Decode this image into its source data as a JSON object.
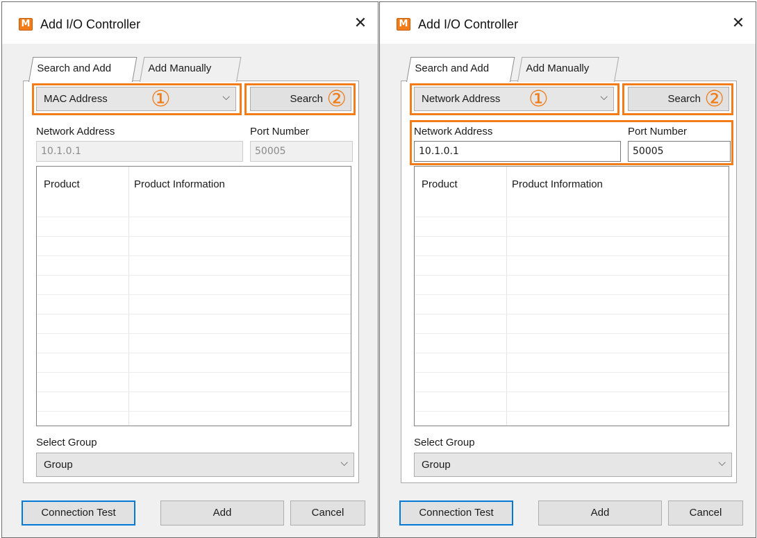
{
  "left": {
    "title": "Add I/O Controller",
    "app_icon": "M",
    "close": "✕",
    "tabs": [
      "Search and Add",
      "Add Manually"
    ],
    "search_type": "MAC Address",
    "search_button": "Search",
    "marker_1": "①",
    "marker_2": "②",
    "network_address_label": "Network Address",
    "port_number_label": "Port Number",
    "network_address_value": "10.1.0.1",
    "port_number_value": "50005",
    "columns": [
      "Product",
      "Product Information"
    ],
    "select_group_label": "Select Group",
    "group_value": "Group",
    "buttons": {
      "connection_test": "Connection Test",
      "add": "Add",
      "cancel": "Cancel"
    }
  },
  "right": {
    "title": "Add I/O Controller",
    "app_icon": "M",
    "close": "✕",
    "tabs": [
      "Search and Add",
      "Add Manually"
    ],
    "search_type": "Network Address",
    "search_button": "Search",
    "marker_1": "①",
    "marker_2": "②",
    "network_address_label": "Network Address",
    "port_number_label": "Port Number",
    "network_address_value": "10.1.0.1",
    "port_number_value": "50005",
    "columns": [
      "Product",
      "Product Information"
    ],
    "select_group_label": "Select Group",
    "group_value": "Group",
    "buttons": {
      "connection_test": "Connection Test",
      "add": "Add",
      "cancel": "Cancel"
    }
  },
  "colors": {
    "highlight": "#f07c1a",
    "default_button_border": "#0078d7",
    "app_icon": "#f07c1a"
  },
  "icons": {
    "app": "app-logo-icon",
    "close": "close-icon",
    "dropdown": "chevron-down-icon"
  }
}
